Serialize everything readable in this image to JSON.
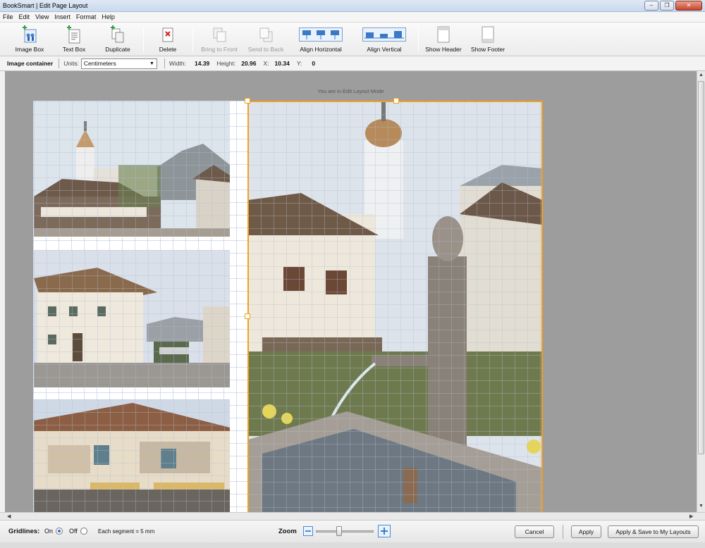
{
  "window": {
    "title": "BookSmart | Edit Page Layout"
  },
  "menu": [
    "File",
    "Edit",
    "View",
    "Insert",
    "Format",
    "Help"
  ],
  "toolbar": {
    "image_box": "Image Box",
    "text_box": "Text Box",
    "duplicate": "Duplicate",
    "delete": "Delete",
    "bring_to_front": "Bring to Front",
    "send_to_back": "Send to Back",
    "align_horizontal": "Align Horizontal",
    "align_vertical": "Align Vertical",
    "show_header": "Show Header",
    "show_footer": "Show Footer"
  },
  "properties": {
    "selection": "Image container",
    "units_label": "Units:",
    "units_value": "Centimeters",
    "width_label": "Width:",
    "width": "14.39",
    "height_label": "Height:",
    "height": "20.96",
    "x_label": "X:",
    "x": "10.34",
    "y_label": "Y:",
    "y": "0"
  },
  "canvas": {
    "mode_note": "You are in Edit Layout Mode"
  },
  "bottom": {
    "gridlines_label": "Gridlines:",
    "on_label": "On",
    "off_label": "Off",
    "segment_note": "Each segment = 5 mm",
    "zoom_label": "Zoom",
    "gridlines_state": "on",
    "cancel": "Cancel",
    "apply": "Apply",
    "apply_save": "Apply & Save to My Layouts"
  },
  "colors": {
    "selection": "#f0a020",
    "workspace": "#9d9d9d",
    "radio_on": "#2a6fd1"
  }
}
